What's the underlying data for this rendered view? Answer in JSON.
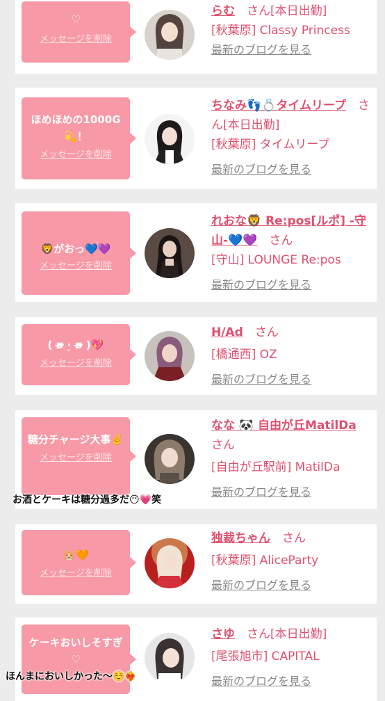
{
  "delete_label": "メッセージを削除",
  "blog_label": "最新のブログを見る",
  "san": "さん",
  "cards": [
    {
      "message": "♡",
      "name": "らむ",
      "status": "[本日出勤]",
      "shop": "[秋葉原] Classy Princess"
    },
    {
      "message": "ほめほめの1000G 💫！",
      "name": "ちなみ👣💍タイムリープ",
      "status": "[本日出勤]",
      "shop": "[秋葉原] タイムリープ"
    },
    {
      "message": "🦁がおっ💙💜",
      "name": "れおな🦁 Re:pos[ルポ] -守山-💙💜",
      "status": "",
      "shop": "[守山] LOUNGE Re:pos"
    },
    {
      "message": "( ʚ̴̶̷̷ ·̮ ʚ̴̶̷̷ )💖",
      "name": "H/Ad",
      "status": "",
      "shop": "[橋通西] OZ"
    },
    {
      "message": "糖分チャージ大事✌️",
      "name": "なな 🐼 自由が丘MatilDa",
      "status": "",
      "shop": "[自由が丘駅前] MatilDa"
    },
    {
      "message": "🐹🧡",
      "name": "独裁ちゃん",
      "status": "",
      "shop": "[秋葉原] AliceParty"
    },
    {
      "message": "ケーキおいしそすぎ♡",
      "name": "さゆ",
      "status": "[本日出勤]",
      "shop": "[尾張旭市] CAPITAL"
    }
  ],
  "overlays": {
    "sweets": "お酒とケーキは糖分過多だ😶💗笑",
    "cake": "ほんまにおいしかった〜☺️❤️‍🔥"
  },
  "colors": {
    "bubble": "#f799a6",
    "name": "#e0506e",
    "blog": "#888888",
    "background": "#ececec"
  }
}
